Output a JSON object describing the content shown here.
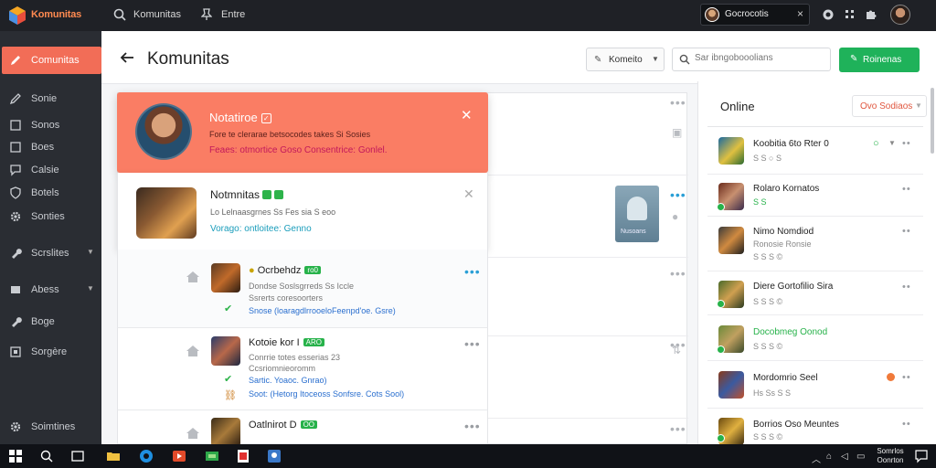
{
  "app": {
    "title": "Komunitas",
    "search_label": "Komunitas",
    "secondary_label": "Entre"
  },
  "topbar": {
    "user_chip": "Gocrocotis",
    "close_glyph": "×"
  },
  "sidebar": {
    "items": [
      {
        "label": "Comunitas",
        "icon": "pen-icon"
      },
      {
        "label": "Sonie",
        "icon": "pen-icon"
      },
      {
        "label": "Sonos",
        "icon": "square-icon"
      },
      {
        "label": "Boes",
        "icon": "square-icon"
      },
      {
        "label": "Calsie",
        "icon": "chat-icon"
      },
      {
        "label": "Botels",
        "icon": "shield-icon"
      },
      {
        "label": "Sonties",
        "icon": "gear-icon"
      },
      {
        "label": "Scrslites",
        "icon": "wrench-icon"
      },
      {
        "label": "Abess",
        "icon": "square-icon"
      },
      {
        "label": "Boge",
        "icon": "wrench-icon"
      },
      {
        "label": "Sorgère",
        "icon": "square-icon"
      },
      {
        "label": "Soimtines",
        "icon": "gear-icon"
      }
    ]
  },
  "header": {
    "title": "Komunitas",
    "filter_label": "Komeito",
    "search_placeholder": "Sar ibngobooolians",
    "action_label": "Roinenas"
  },
  "notification": {
    "title": "Notatiroe",
    "body": "Fore te clerarae betsocodes takes Si Sosies",
    "meta": "Feaes: otmortice Goso Consentrice: Gonlel."
  },
  "post": {
    "title": "Notmnitas",
    "body": "Lo Lelnaasgrnes Ss Fes sia S eoo",
    "meta": "Vorago: ontloitee: Genno"
  },
  "comments": [
    {
      "name": "Ocrbehdz",
      "badge": "ro0",
      "text1": "Dondse Soslsgrreds Ss Iccle",
      "text2": "Ssrerts coresoorters",
      "meta": "Snose (loaragdlrrooeloFeenpd'oe. Gsre)"
    },
    {
      "name": "Kotoie kor I",
      "badge": "ARO",
      "text1": "Conrrie totes esserias 23",
      "text2": "Ccsriomnieoromm",
      "meta": "Sartic. Yoaoc. Gnrao)",
      "meta2": "Soot: (Hetorg Itoceoss Sonfsre. Cots Sool)"
    },
    {
      "name": "Oatlnirot D",
      "badge": "OO"
    }
  ],
  "side_card_label": "Nusoans",
  "online": {
    "title": "Online",
    "filter_label": "Ovo Sodiaos",
    "users": [
      {
        "name": "Koobitia 6to Rter 0",
        "sub": "S S ○ S"
      },
      {
        "name": "Rolaro Kornatos",
        "sub": "S S"
      },
      {
        "name": "Nimo Nomdiod",
        "sub": "Ronosie Ronsie",
        "sub2": "S S S ©"
      },
      {
        "name": "Diere Gortofilio Sira",
        "sub": "S S S ©"
      },
      {
        "name": "Docobmeg Oonod",
        "sub": "S S S ©"
      },
      {
        "name": "Mordomrio Seel",
        "sub": "Hs Ss S S"
      },
      {
        "name": "Borrios Oso Meuntes",
        "sub": "S S S ©"
      }
    ]
  },
  "taskbar": {
    "clock_line1": "Somrlos",
    "clock_line2": "Oonrton"
  },
  "colors": {
    "accent": "#f26d57",
    "brand_green": "#1fb25a",
    "sidebar_bg": "#2a2d33",
    "topbar_bg": "#1f2126"
  }
}
